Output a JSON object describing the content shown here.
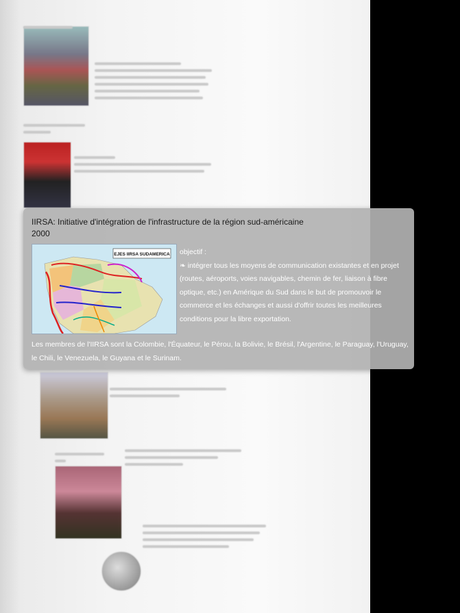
{
  "card": {
    "title": "IIRSA: Initiative d'intégration de l'infrastructure de la région sud-américaine",
    "year": "2000",
    "map_label": "EJES IIRSA SUDAMERICA",
    "objective_heading": "objectif :",
    "objective_bullet": "❧",
    "objective_text": "intégrer tous les moyens de communication existantes et en projet (routes, aéroports, voies navigables, chemin de fer, liaison à fibre optique, etc.) en Amérique du Sud dans le but de promouvoir le commerce et les échanges et aussi d'offrir toutes les meilleures conditions pour la libre exportation.",
    "members": "Les membres de l'IIRSA sont la Colombie, l'Équateur, le Pérou, la Bolivie, le Brésil, l'Argentine, le Paraguay, l'Uruguay, le Chili, le Venezuela, le Guyana et le Surinam."
  },
  "colors": {
    "card_bg": "#b2b2b2",
    "right_bar": "#000000",
    "page_bg": "#f4f4f4"
  }
}
